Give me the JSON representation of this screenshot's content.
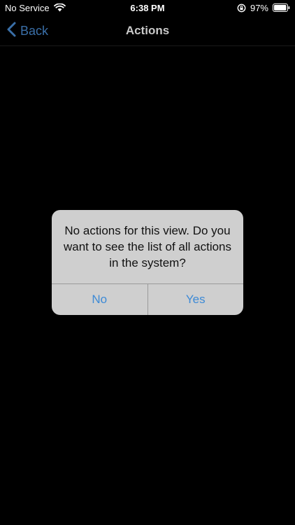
{
  "status_bar": {
    "carrier": "No Service",
    "time": "6:38 PM",
    "battery_percent": "97%",
    "battery_level": 0.97,
    "icons": [
      "wifi-icon",
      "orientation-lock-icon",
      "battery-icon"
    ]
  },
  "nav_bar": {
    "back_label": "Back",
    "title": "Actions",
    "back_icon": "chevron-left-icon"
  },
  "alert": {
    "message": "No actions for this view. Do you want to see the list of all actions in the system?",
    "no_label": "No",
    "yes_label": "Yes"
  },
  "colors": {
    "background": "#000000",
    "back_tint": "#3a6fa8",
    "alert_background": "#cfcfcf",
    "alert_button": "#3d8ad6"
  }
}
